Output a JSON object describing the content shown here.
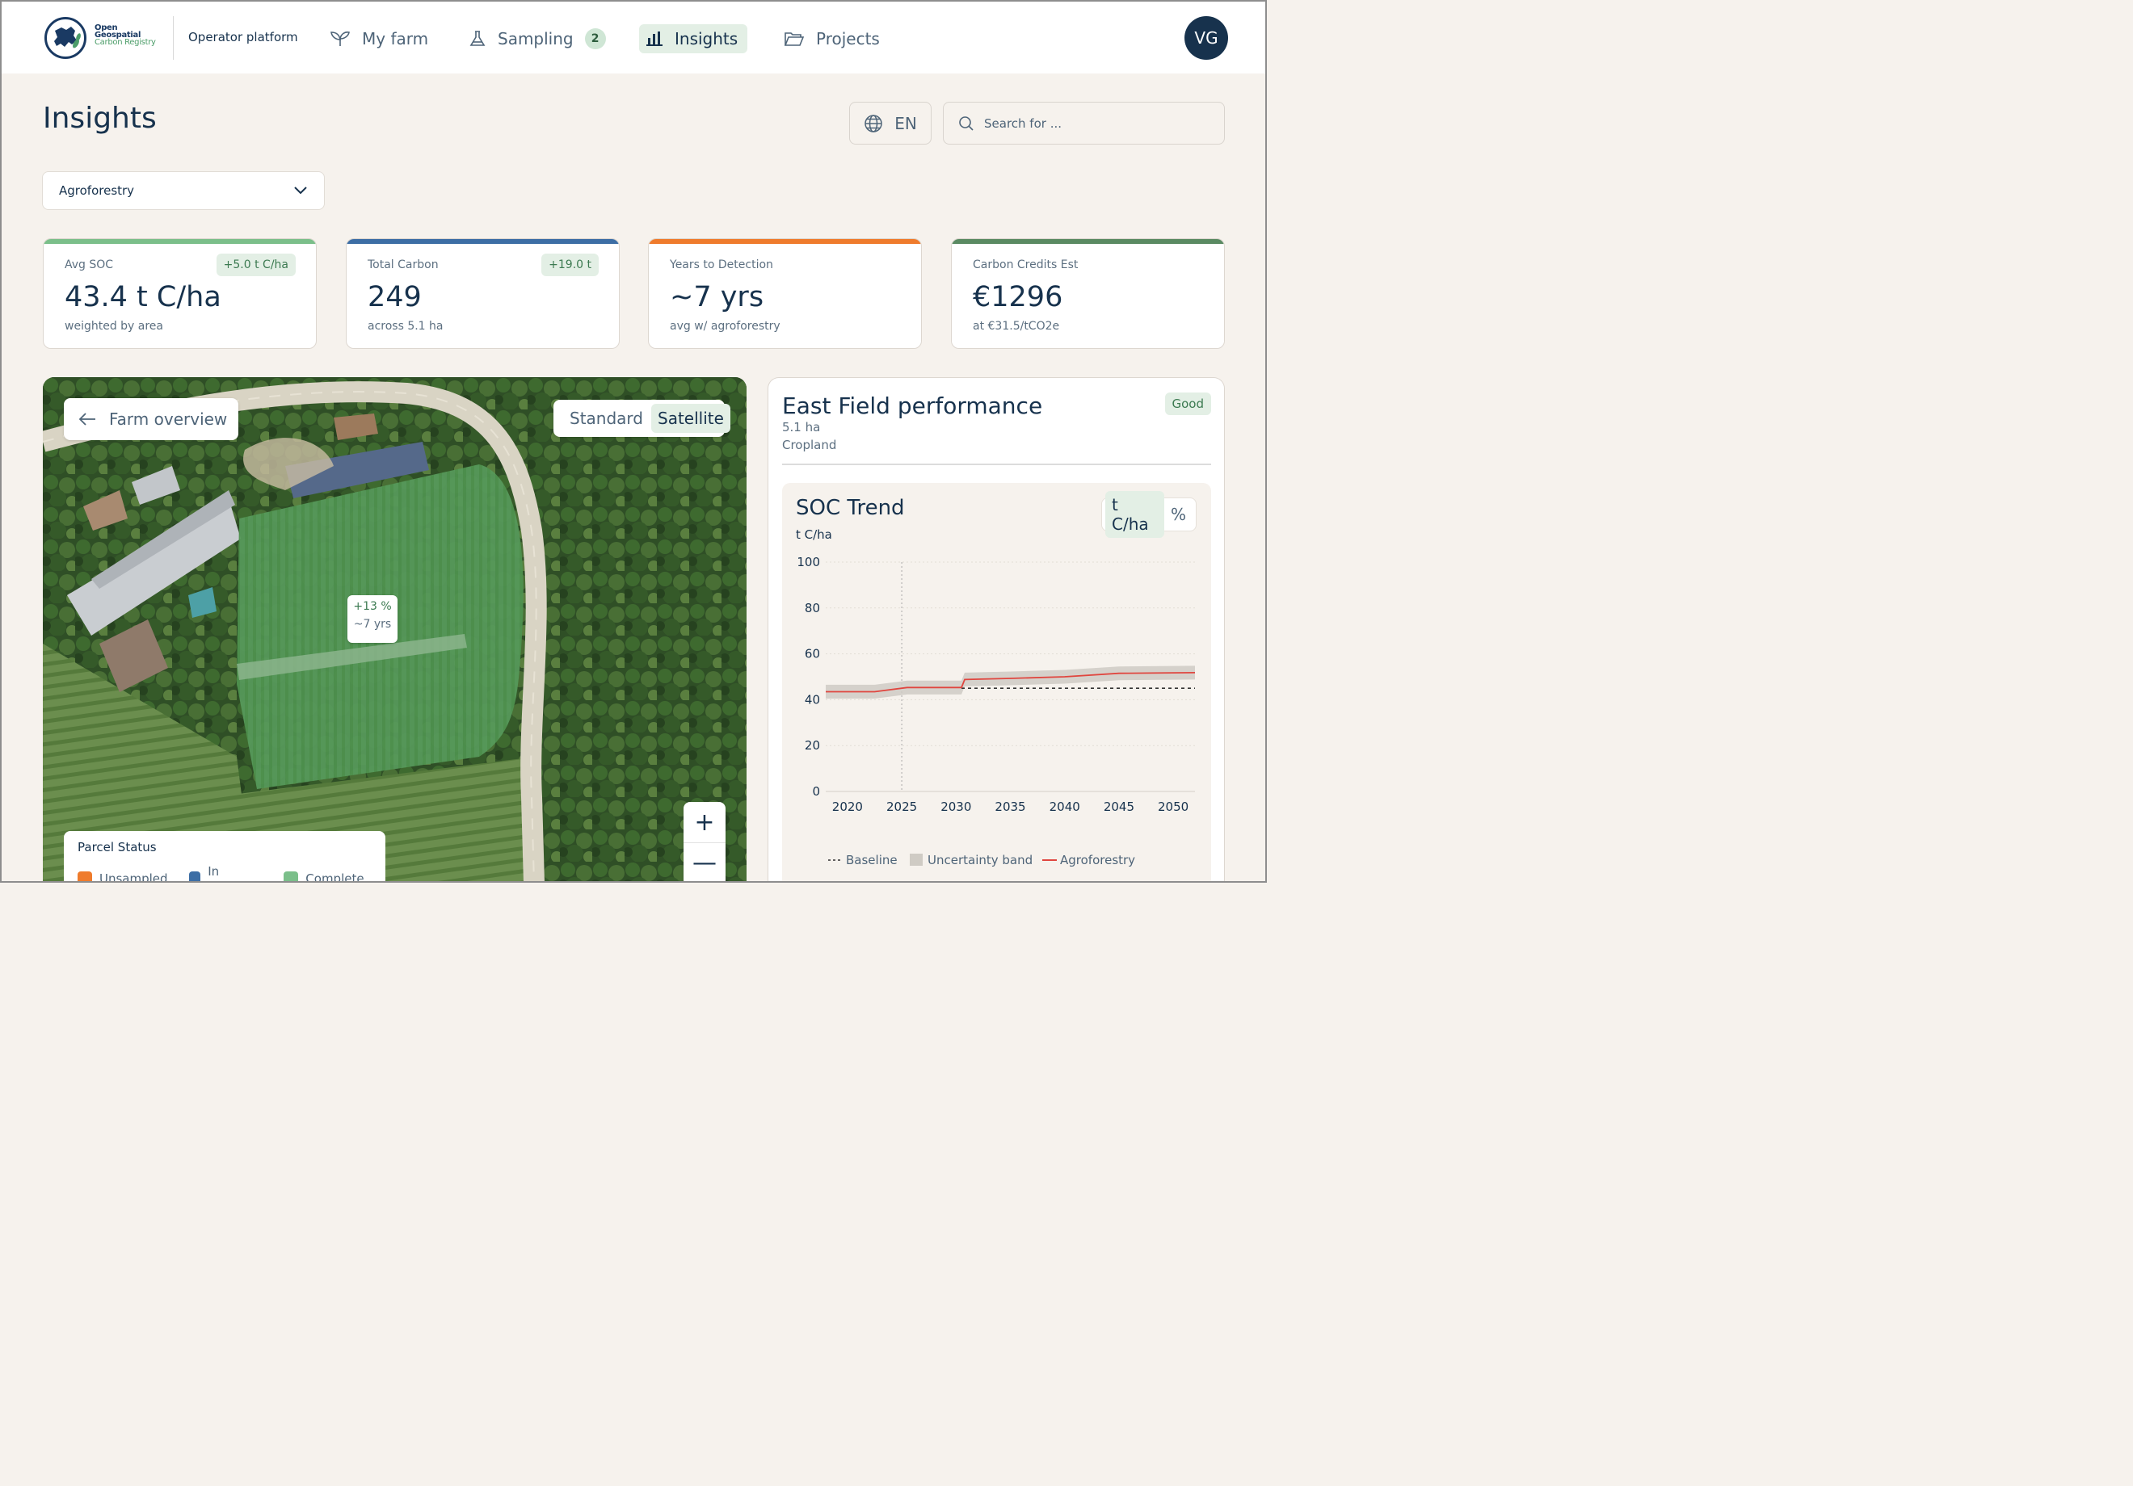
{
  "brand": {
    "logo_line1": "Open",
    "logo_line2": "Geospatial",
    "logo_line3": "Carbon Registry",
    "platform_label": "Operator platform"
  },
  "nav": {
    "my_farm": "My farm",
    "sampling": "Sampling",
    "sampling_count": "2",
    "insights": "Insights",
    "projects": "Projects",
    "active": "Insights"
  },
  "user": {
    "initials": "VG"
  },
  "page": {
    "title": "Insights",
    "language": "EN",
    "search_placeholder": "Search for ..."
  },
  "scenario_select": {
    "value": "Agroforestry"
  },
  "kpis": [
    {
      "label": "Avg SOC",
      "value": "43.4 t C/ha",
      "sub": "weighted by area",
      "delta": "+5.0 t C/ha",
      "color": "#7bbf8a"
    },
    {
      "label": "Total Carbon",
      "value": "249",
      "sub": "across 5.1 ha",
      "delta": "+19.0 t",
      "color": "#3d6ea5"
    },
    {
      "label": "Years to Detection",
      "value": "~7 yrs",
      "sub": "avg w/ agroforestry",
      "delta": "",
      "color": "#ef7b2c"
    },
    {
      "label": "Carbon Credits Est",
      "value": "€1296",
      "sub": "at €31.5/tCO2e",
      "delta": "",
      "color": "#5a8a62"
    }
  ],
  "map": {
    "back_label": "Farm overview",
    "view_standard": "Standard",
    "view_satellite": "Satellite",
    "active_view": "Satellite",
    "tooltip_change": "+13 %",
    "tooltip_years": "~7 yrs",
    "zoom_in": "+",
    "zoom_out": "—",
    "legend": {
      "title": "Parcel Status",
      "items": [
        {
          "label": "Unsampled",
          "color": "#ef7b2c"
        },
        {
          "label": "In progress",
          "color": "#3d6ea5"
        },
        {
          "label": "Complete",
          "color": "#7bbf8a"
        }
      ]
    }
  },
  "field_panel": {
    "title": "East Field performance",
    "area": "5.1 ha",
    "land_use": "Cropland",
    "rating": "Good"
  },
  "soc_chart": {
    "title": "SOC Trend",
    "unit_label": "t C/ha",
    "toggle_units": [
      "t C/ha",
      "%"
    ],
    "active_unit": "t C/ha"
  },
  "chart_data": {
    "type": "line",
    "title": "SOC Trend",
    "ylabel": "t C/ha",
    "xlim": [
      2018,
      2052
    ],
    "ylim": [
      0,
      100
    ],
    "x_ticks": [
      2020,
      2025,
      2030,
      2035,
      2040,
      2045,
      2050
    ],
    "y_ticks": [
      0,
      20,
      40,
      60,
      80,
      100
    ],
    "grid": true,
    "legend_position": "bottom",
    "reference_year": 2025,
    "series": [
      {
        "name": "Baseline",
        "style": "dashed",
        "color": "#333333",
        "x": [
          2030.5,
          2052
        ],
        "y": [
          45,
          45
        ]
      },
      {
        "name": "Agroforestry",
        "style": "line",
        "color": "#e0463f",
        "x": [
          2018,
          2022.5,
          2025.5,
          2030.5,
          2030.8,
          2035,
          2040,
          2045,
          2052
        ],
        "y": [
          43.5,
          43.5,
          45.3,
          45.3,
          48.8,
          49.3,
          50,
          51.5,
          51.8
        ]
      },
      {
        "name": "Uncertainty band",
        "style": "band",
        "color": "#cfcbc4",
        "x": [
          2018,
          2022.5,
          2025.5,
          2030.5,
          2030.8,
          2035,
          2040,
          2045,
          2052
        ],
        "y_low": [
          40.5,
          40.5,
          42.3,
          42.3,
          45.8,
          46.3,
          47,
          48.5,
          48.8
        ],
        "y_high": [
          46.5,
          46.5,
          48.3,
          48.3,
          51.8,
          52.3,
          53,
          54.5,
          54.8
        ]
      }
    ]
  }
}
